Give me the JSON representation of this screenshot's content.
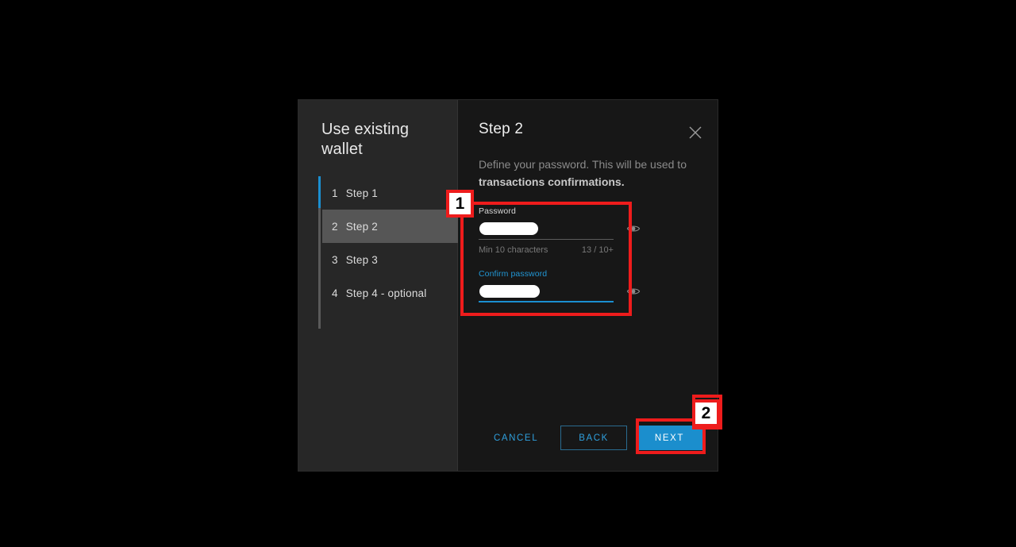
{
  "window": {
    "background_color": "#000000"
  },
  "dialog": {
    "background_color": "#171717",
    "sidebar_color": "#272727",
    "accent_color": "#1b8fd0"
  },
  "sidebar": {
    "title": "Use existing wallet",
    "steps": [
      {
        "num": "1",
        "label": "Step 1",
        "selected": false
      },
      {
        "num": "2",
        "label": "Step 2",
        "selected": true
      },
      {
        "num": "3",
        "label": "Step 3",
        "selected": false
      },
      {
        "num": "4",
        "label": "Step 4 - optional",
        "selected": false
      }
    ]
  },
  "content": {
    "title": "Step 2",
    "close_icon": "close-icon",
    "description_lead": "Define your password. This will be used to ",
    "description_bold": "transactions confirmations.",
    "password_field": {
      "label": "Password",
      "value": "",
      "redacted": true,
      "eye_icon": "eye-icon",
      "helper_left": "Min 10 characters",
      "helper_right": "13 / 10+",
      "focused": false
    },
    "confirm_field": {
      "label": "Confirm password",
      "value": "",
      "redacted": true,
      "eye_icon": "eye-icon",
      "focused": true
    }
  },
  "footer": {
    "cancel_label": "CANCEL",
    "back_label": "BACK",
    "next_label": "NEXT"
  },
  "annotations": {
    "badge_1": "1",
    "badge_2": "2",
    "color": "#ee1c1c"
  }
}
